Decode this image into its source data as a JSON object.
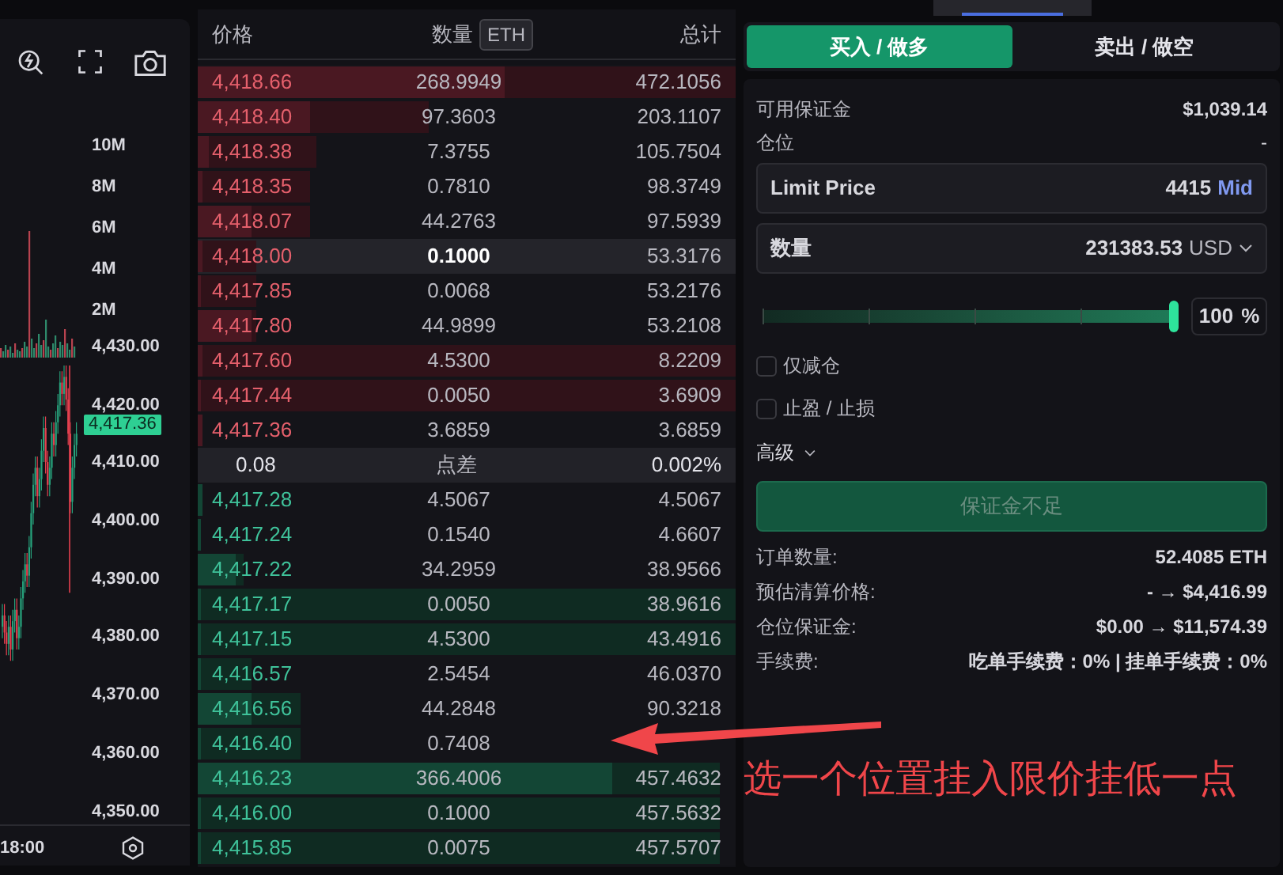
{
  "chart": {
    "volume_axis": [
      "10M",
      "8M",
      "6M",
      "4M",
      "2M"
    ],
    "price_axis": [
      "4,430.00",
      "4,420.00",
      "4,410.00",
      "4,400.00",
      "4,390.00",
      "4,380.00",
      "4,370.00",
      "4,360.00",
      "4,350.00"
    ],
    "last_price": "4,417.36",
    "time_label": "18:00"
  },
  "order_book": {
    "columns": [
      "价格",
      "数量",
      "总计"
    ],
    "unit": "ETH",
    "asks": [
      {
        "price": "4,418.66",
        "amount": "268.9949",
        "total": "472.1056",
        "highlighted": false,
        "size_bar": {
          "level": 0.57
        },
        "depth_bar": {
          "level": 1
        }
      },
      {
        "price": "4,418.40",
        "amount": "97.3603",
        "total": "203.1107",
        "highlighted": false,
        "size_bar": {
          "level": 0.21
        },
        "depth_bar": {
          "level": 0.43
        }
      },
      {
        "price": "4,418.38",
        "amount": "7.3755",
        "total": "105.7504",
        "highlighted": false,
        "size_bar": {
          "level": 0.02
        },
        "depth_bar": {
          "level": 0.22
        }
      },
      {
        "price": "4,418.35",
        "amount": "0.7810",
        "total": "98.3749",
        "highlighted": false,
        "size_bar": {
          "level": 0.01
        },
        "depth_bar": {
          "level": 0.21
        }
      },
      {
        "price": "4,418.07",
        "amount": "44.2763",
        "total": "97.5939",
        "highlighted": false,
        "size_bar": {
          "level": 0.1
        },
        "depth_bar": {
          "level": 0.21
        }
      },
      {
        "price": "4,418.00",
        "amount": "0.1000",
        "total": "53.3176",
        "highlighted": true,
        "size_bar": {
          "level": 0.01
        },
        "depth_bar": {
          "level": 0.11
        }
      },
      {
        "price": "4,417.85",
        "amount": "0.0068",
        "total": "53.2176",
        "highlighted": false,
        "size_bar": {
          "level": 0.005
        },
        "depth_bar": {
          "level": 0.11
        }
      },
      {
        "price": "4,417.80",
        "amount": "44.9899",
        "total": "53.2108",
        "highlighted": false,
        "size_bar": {
          "level": 0.1
        },
        "depth_bar": {
          "level": 0.11
        }
      },
      {
        "price": "4,417.60",
        "amount": "4.5300",
        "total": "8.2209",
        "highlighted": false,
        "size_bar": {
          "level": 0.01
        },
        "depth_bar": {
          "level": 1
        }
      },
      {
        "price": "4,417.44",
        "amount": "0.0050",
        "total": "3.6909",
        "highlighted": false,
        "size_bar": {
          "level": 0.005
        },
        "depth_bar": {
          "level": 1
        }
      },
      {
        "price": "4,417.36",
        "amount": "3.6859",
        "total": "3.6859",
        "highlighted": false,
        "size_bar": {
          "level": 0.01
        },
        "depth_bar": {
          "level": 0.01
        }
      }
    ],
    "spread": {
      "value": "0.08",
      "label": "点差",
      "percent": "0.002%"
    },
    "bids": [
      {
        "price": "4,417.28",
        "amount": "4.5067",
        "total": "4.5067",
        "highlighted": false,
        "size_bar": {
          "level": 0.01
        },
        "depth_bar": {
          "level": 0.01
        }
      },
      {
        "price": "4,417.24",
        "amount": "0.1540",
        "total": "4.6607",
        "highlighted": false,
        "size_bar": {
          "level": 0.005
        },
        "depth_bar": {
          "level": 0.005
        }
      },
      {
        "price": "4,417.22",
        "amount": "34.2959",
        "total": "38.9566",
        "highlighted": false,
        "size_bar": {
          "level": 0.07
        },
        "depth_bar": {
          "level": 0.085
        }
      },
      {
        "price": "4,417.17",
        "amount": "0.0050",
        "total": "38.9616",
        "highlighted": false,
        "size_bar": {
          "level": 0.005
        },
        "depth_bar": {
          "level": 1
        }
      },
      {
        "price": "4,417.15",
        "amount": "4.5300",
        "total": "43.4916",
        "highlighted": false,
        "size_bar": {
          "level": 0.005
        },
        "depth_bar": {
          "level": 1
        }
      },
      {
        "price": "4,416.57",
        "amount": "2.5454",
        "total": "46.0370",
        "highlighted": false,
        "size_bar": {
          "level": 0.005
        },
        "depth_bar": {
          "level": 0.1
        }
      },
      {
        "price": "4,416.56",
        "amount": "44.2848",
        "total": "90.3218",
        "highlighted": false,
        "size_bar": {
          "level": 0.1
        },
        "depth_bar": {
          "level": 0.19
        }
      },
      {
        "price": "4,416.40",
        "amount": "0.7408",
        "highlighted": false,
        "size_bar": {
          "level": 0.005
        },
        "depth_bar": {
          "level": 0.19
        }
      },
      {
        "price": "4,416.23",
        "amount": "366.4006",
        "total": "457.4632",
        "highlighted": false,
        "size_bar": {
          "level": 0.77
        },
        "depth_bar": {
          "level": 0.97
        }
      },
      {
        "price": "4,416.00",
        "amount": "0.1000",
        "total": "457.5632",
        "highlighted": false,
        "size_bar": {
          "level": 0.005
        },
        "depth_bar": {
          "level": 0.97
        }
      },
      {
        "price": "4,415.85",
        "amount": "0.0075",
        "total": "457.5707",
        "highlighted": false,
        "size_bar": {
          "level": 0.005
        },
        "depth_bar": {
          "level": 0.97
        }
      }
    ]
  },
  "order_form": {
    "sides": [
      {
        "label": "买入 / 做多",
        "selected": true
      },
      {
        "label": "卖出 / 做空",
        "selected": false
      }
    ],
    "available": {
      "label": "可用保证金",
      "value": "$1,039.14"
    },
    "position": {
      "label": "仓位",
      "value": "-"
    },
    "limit_price": {
      "label": "Limit Price",
      "value": "4415",
      "mid": "Mid"
    },
    "quantity": {
      "label": "数量",
      "value": "231383.53",
      "unit": "USD"
    },
    "slider": {
      "level": 1,
      "value": "100",
      "unit": "%"
    },
    "options": [
      {
        "label": "仅减仓",
        "checked": false
      },
      {
        "label": "止盈 / 止损",
        "checked": false
      }
    ],
    "advanced": {
      "label": "高级",
      "expanded": false
    },
    "submit": {
      "label": "保证金不足",
      "disabled": true
    },
    "summary": [
      {
        "label": "订单数量:",
        "value": "52.4085 ETH"
      },
      {
        "label": "预估清算价格:",
        "value": "- → $4,416.99"
      },
      {
        "label": "仓位保证金:",
        "value": "$0.00 → $11,574.39"
      },
      {
        "label": "手续费:",
        "value": "吃单手续费：0% | 挂单手续费：0%"
      }
    ]
  },
  "annotation": {
    "text": "选一个位置挂入限价挂低一点"
  }
}
